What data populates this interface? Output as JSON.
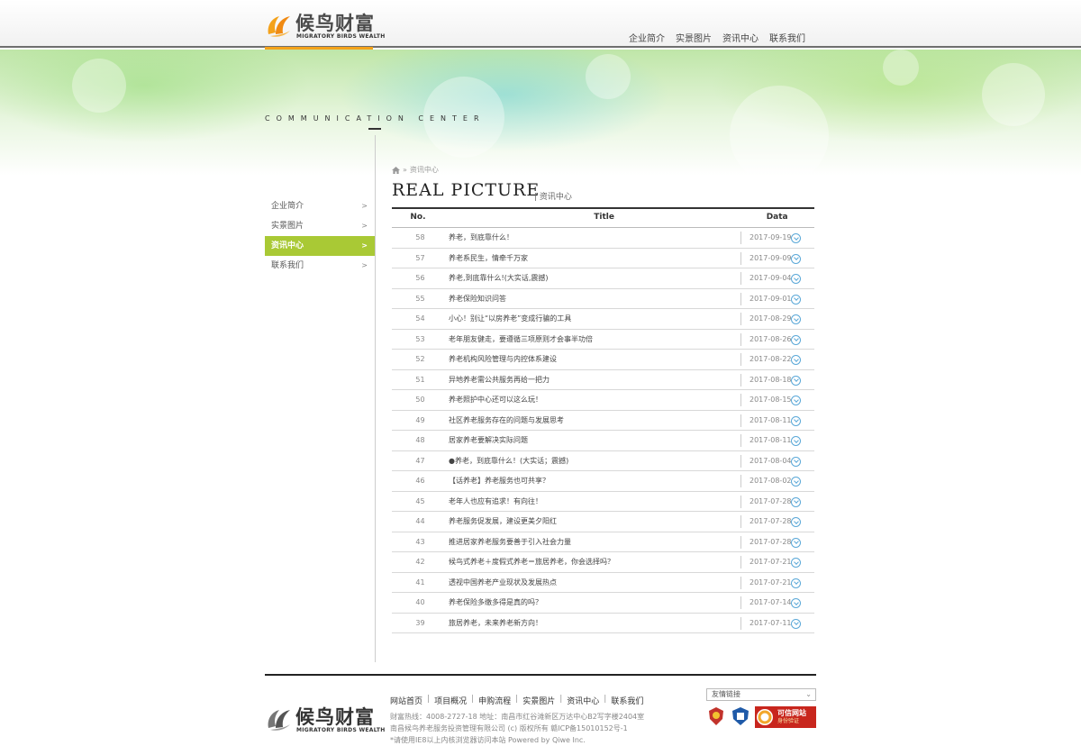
{
  "brand": {
    "name_cn": "候鸟财富",
    "name_en": "MIGRATORY BIRDS WEALTH",
    "accent": "#f4a21b"
  },
  "nav": [
    "企业简介",
    "实景图片",
    "资讯中心",
    "联系我们"
  ],
  "banner": {
    "caption": "COMMUNICATION CENTER"
  },
  "sidebar": {
    "items": [
      {
        "label": "企业简介",
        "arrow": ">"
      },
      {
        "label": "实景图片",
        "arrow": ">"
      },
      {
        "label": "资讯中心",
        "arrow": ">",
        "active": true
      },
      {
        "label": "联系我们",
        "arrow": ">"
      }
    ],
    "active_color": "#a9c935"
  },
  "breadcrumb": {
    "sep": "»",
    "current": "资讯中心"
  },
  "page": {
    "title_en": "REAL PICTURE",
    "title_cn": "| 资讯中心"
  },
  "table": {
    "headers": {
      "no": "No.",
      "title": "Title",
      "date": "Data"
    },
    "rows": [
      {
        "no": "58",
        "title": "养老，到底靠什么！",
        "date": "2017-09-19"
      },
      {
        "no": "57",
        "title": "养老系民生，情牵千万家",
        "date": "2017-09-09"
      },
      {
        "no": "56",
        "title": "养老,到底靠什么!(大实话,震撼)",
        "date": "2017-09-04"
      },
      {
        "no": "55",
        "title": "养老保险知识问答",
        "date": "2017-09-01"
      },
      {
        "no": "54",
        "title": "小心！别让“以房养老”变成行骗的工具",
        "date": "2017-08-29"
      },
      {
        "no": "53",
        "title": "老年朋友健走，要遵循三项原则才会事半功倍",
        "date": "2017-08-26"
      },
      {
        "no": "52",
        "title": "养老机构风险管理与内控体系建设",
        "date": "2017-08-22"
      },
      {
        "no": "51",
        "title": "异地养老需公共服务再给一把力",
        "date": "2017-08-18"
      },
      {
        "no": "50",
        "title": "养老照护中心还可以这么玩！",
        "date": "2017-08-15"
      },
      {
        "no": "49",
        "title": "社区养老服务存在的问题与发展思考",
        "date": "2017-08-11"
      },
      {
        "no": "48",
        "title": "居家养老要解决实际问题",
        "date": "2017-08-11"
      },
      {
        "no": "47",
        "title": "●养老，到底靠什么！(大实话；震撼)",
        "date": "2017-08-04"
      },
      {
        "no": "46",
        "title": "【话养老】养老服务也可共享？",
        "date": "2017-08-02"
      },
      {
        "no": "45",
        "title": "老年人也应有追求！有向往！",
        "date": "2017-07-28"
      },
      {
        "no": "44",
        "title": "养老服务促发展，建设更美夕阳红",
        "date": "2017-07-28"
      },
      {
        "no": "43",
        "title": "推进居家养老服务要善于引入社会力量",
        "date": "2017-07-28"
      },
      {
        "no": "42",
        "title": "候鸟式养老＋度假式养老＝旅居养老，你会选择吗？",
        "date": "2017-07-21"
      },
      {
        "no": "41",
        "title": "透视中国养老产业现状及发展热点",
        "date": "2017-07-21"
      },
      {
        "no": "40",
        "title": "养老保险多缴多得是真的吗？",
        "date": "2017-07-14"
      },
      {
        "no": "39",
        "title": "旅居养老，未来养老新方向！",
        "date": "2017-07-11"
      }
    ]
  },
  "footer": {
    "links": [
      "网站首页",
      "项目概况",
      "申购流程",
      "实景图片",
      "资讯中心",
      "联系我们"
    ],
    "line1": "财富热线：4008-2727-18 地址：南昌市红谷滩新区万达中心B2写字楼2404室",
    "line2": "南昌候鸟养老服务投资管理有限公司 (c) 版权所有 赣ICP备15010152号-1",
    "line3": "*请使用IE8以上内核浏览器访问本站 Powered by Qiwe Inc.",
    "select_value": "友情链接",
    "badge_text": "可信网站",
    "badge_sub": "身份验证"
  }
}
